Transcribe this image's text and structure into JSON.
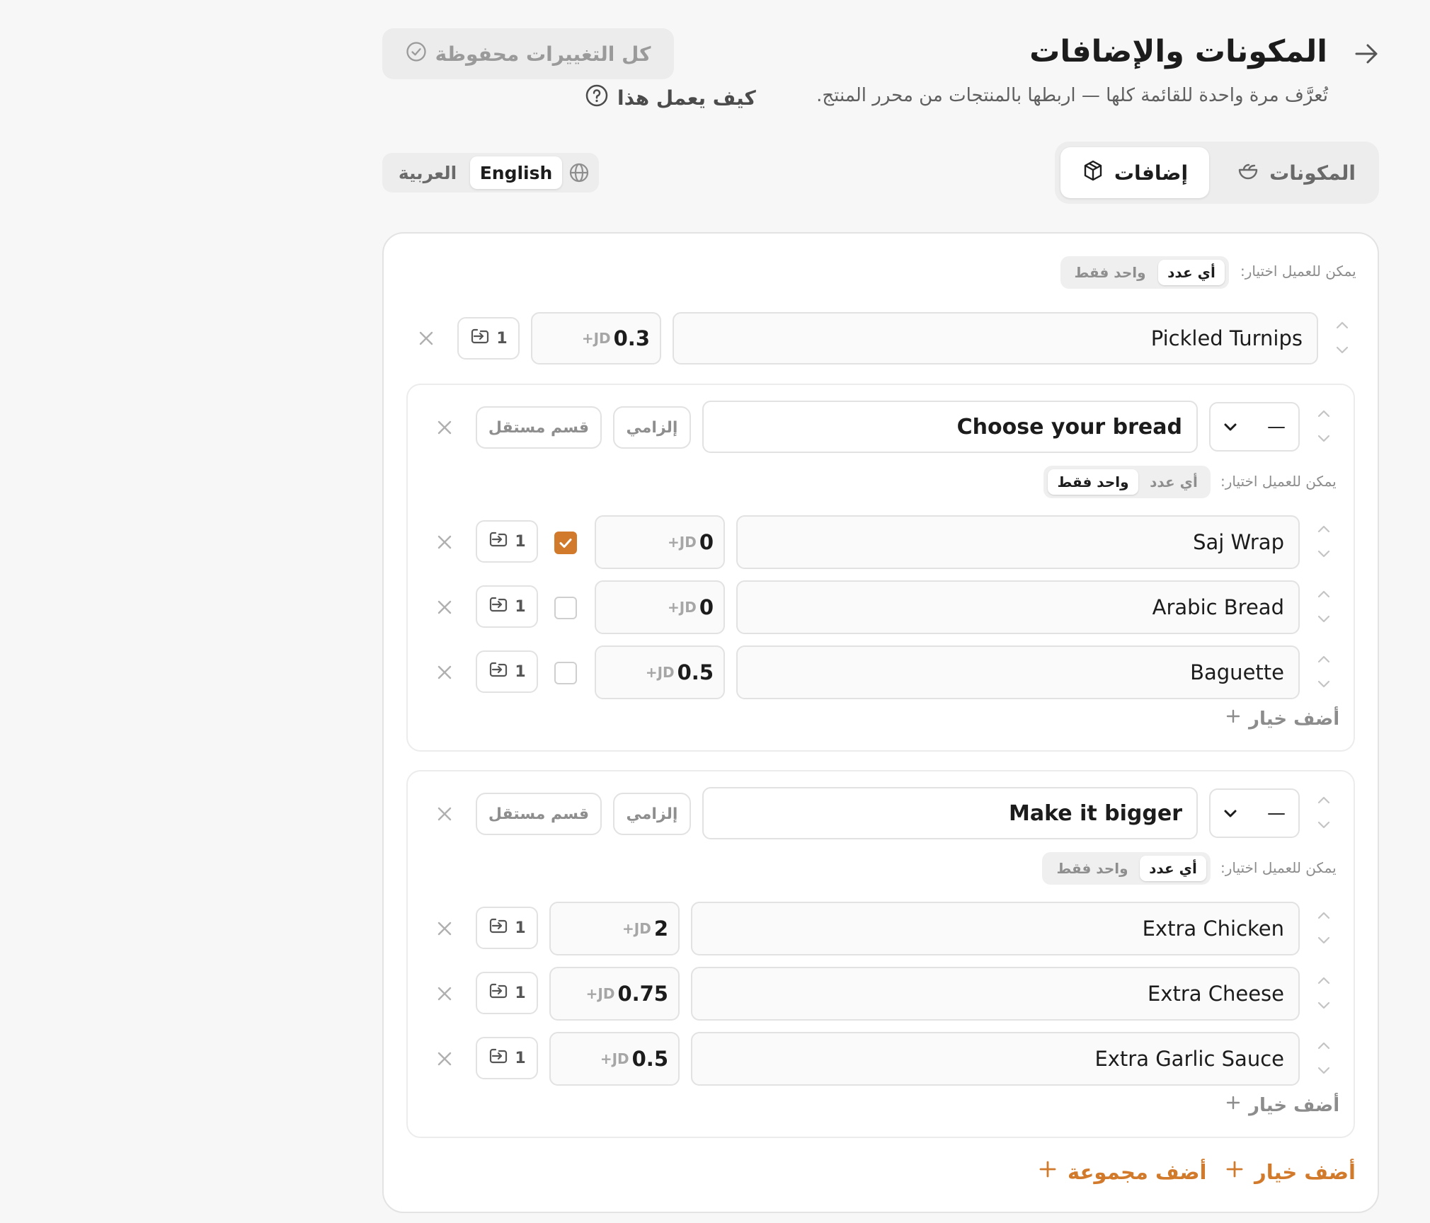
{
  "header": {
    "title": "المكونات والإضافات",
    "subtitle": "تُعرَّف مرة واحدة للقائمة كلها — اربطها بالمنتجات من محرر المنتج.",
    "how_it_works": "كيف يعمل هذا",
    "saved_status": "كل التغييرات محفوظة"
  },
  "tabs": [
    {
      "label": "المكونات",
      "active": false
    },
    {
      "label": "إضافات",
      "active": true
    }
  ],
  "language": {
    "options": [
      "English",
      "العربية"
    ],
    "selected": "English"
  },
  "labels": {
    "can_choose": "يمكن للعميل اختيار:",
    "any_number": "أي عدد",
    "only_one": "واحد فقط",
    "required": "إلزامي",
    "separate_section": "قسم مستقل",
    "add_option": "أضف خيار",
    "add_group": "أضف مجموعة",
    "currency": "+JD",
    "dash": "—"
  },
  "top_mode": "any",
  "top_option": {
    "name": "Pickled Turnips",
    "price": "0.3",
    "qty": "1"
  },
  "groups": [
    {
      "name": "Choose your bread",
      "mode": "one",
      "options": [
        {
          "name": "Saj Wrap",
          "price": "0",
          "qty": "1",
          "checked": true
        },
        {
          "name": "Arabic Bread",
          "price": "0",
          "qty": "1",
          "checked": false
        },
        {
          "name": "Baguette",
          "price": "0.5",
          "qty": "1",
          "checked": false
        }
      ]
    },
    {
      "name": "Make it bigger",
      "mode": "any",
      "options": [
        {
          "name": "Extra Chicken",
          "price": "2",
          "qty": "1"
        },
        {
          "name": "Extra Cheese",
          "price": "0.75",
          "qty": "1"
        },
        {
          "name": "Extra Garlic Sauce",
          "price": "0.5",
          "qty": "1"
        }
      ]
    }
  ],
  "colors": {
    "accent": "#d27a2c"
  }
}
